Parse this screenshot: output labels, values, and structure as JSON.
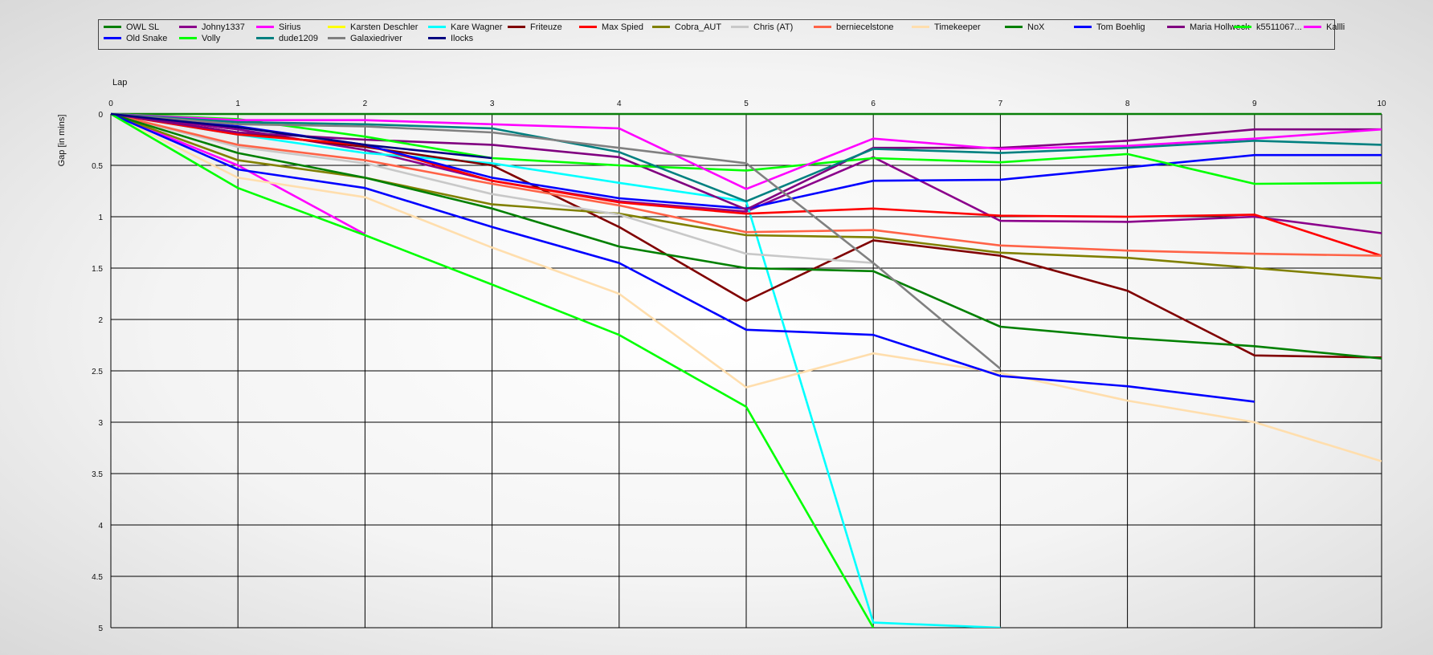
{
  "chart_data": {
    "type": "line",
    "xlabel": "Lap",
    "ylabel": "Gap [in mins]",
    "x_ticks": [
      "0",
      "1",
      "2",
      "3",
      "4",
      "5",
      "6",
      "7",
      "8",
      "9",
      "10"
    ],
    "y_ticks": [
      "0",
      "0.5",
      "1",
      "1.5",
      "2",
      "2.5",
      "3",
      "3.5",
      "4",
      "4.5",
      "5"
    ],
    "xlim": [
      0,
      10
    ],
    "ylim": [
      0,
      5
    ],
    "y_inverted": true,
    "grid": true,
    "legend_position": "top",
    "series": [
      {
        "name": "OWL SL",
        "color": "#087f08",
        "values": [
          0,
          0,
          0,
          0,
          0,
          0,
          0,
          0,
          0,
          0,
          0
        ]
      },
      {
        "name": "Johny1337",
        "color": "#8b008b",
        "values": [
          0,
          0.15,
          0.35,
          0.65,
          0.85,
          0.95,
          0.42,
          1.04,
          1.05,
          1.0,
          1.16
        ]
      },
      {
        "name": "Sirius",
        "color": "#ff00ff",
        "values": [
          0,
          0.5,
          1.17
        ]
      },
      {
        "name": "Karsten Deschler",
        "color": "#ffff00",
        "values": []
      },
      {
        "name": "Kare Wagner",
        "color": "#00ffff",
        "values": [
          0,
          0.2,
          0.38,
          0.48,
          0.67,
          0.85,
          4.95,
          5.0
        ]
      },
      {
        "name": "Friteuze",
        "color": "#800000",
        "values": [
          0,
          0.18,
          0.32,
          0.5,
          1.1,
          1.82,
          1.23,
          1.38,
          1.72,
          2.35,
          2.37
        ]
      },
      {
        "name": "Max Spied",
        "color": "#ff0000",
        "values": [
          0,
          0.2,
          0.3,
          0.65,
          0.86,
          0.97,
          0.92,
          0.99,
          1.0,
          0.98,
          1.38
        ]
      },
      {
        "name": "Cobra_AUT",
        "color": "#808000",
        "values": [
          0,
          0.45,
          0.62,
          0.88,
          0.97,
          1.18,
          1.2,
          1.35,
          1.4,
          1.5,
          1.6
        ]
      },
      {
        "name": "Chris (AT)",
        "color": "#c8c8c8",
        "values": [
          0,
          0.32,
          0.48,
          0.78,
          0.98,
          1.36,
          1.45
        ]
      },
      {
        "name": "berniecelstone",
        "color": "#ff6347",
        "values": [
          0,
          0.3,
          0.45,
          0.68,
          0.89,
          1.15,
          1.13,
          1.28,
          1.33,
          1.36,
          1.38
        ]
      },
      {
        "name": "Timekeeper",
        "color": "#ffdead",
        "values": [
          0,
          0.62,
          0.81,
          1.3,
          1.75,
          2.66,
          2.33,
          2.52,
          2.79,
          3.0,
          3.38
        ]
      },
      {
        "name": "NoX",
        "color": "#008000",
        "values": [
          0,
          0.38,
          0.62,
          0.92,
          1.29,
          1.5,
          1.53,
          2.07,
          2.18,
          2.26,
          2.38
        ]
      },
      {
        "name": "Tom Boehlig",
        "color": "#0000ff",
        "values": [
          0,
          0.12,
          0.3,
          0.62,
          0.82,
          0.92,
          0.65,
          0.64,
          0.52,
          0.4,
          0.4
        ]
      },
      {
        "name": "Maria Hollweck",
        "color": "#800080",
        "values": [
          0,
          0.18,
          0.25,
          0.3,
          0.42,
          0.93,
          0.33,
          0.33,
          0.26,
          0.15,
          0.15
        ]
      },
      {
        "name": "k5511067...",
        "color": "#00ff00",
        "values": [
          0,
          0.05,
          0.22,
          0.43,
          0.5,
          0.55,
          0.43,
          0.47,
          0.39,
          0.68,
          0.67
        ]
      },
      {
        "name": "Kallli",
        "color": "#ff00ff",
        "values": [
          0,
          0.06,
          0.06,
          0.1,
          0.14,
          0.73,
          0.24,
          0.34,
          0.31,
          0.24,
          0.15
        ]
      },
      {
        "name": "Old Snake",
        "color": "#0000ff",
        "values": [
          0,
          0.54,
          0.72,
          1.1,
          1.45,
          2.1,
          2.15,
          2.55,
          2.65,
          2.8
        ]
      },
      {
        "name": "Volly",
        "color": "#00ff00",
        "values": [
          0,
          0.72,
          1.18,
          1.66,
          2.15,
          2.85,
          5.0
        ]
      },
      {
        "name": "dude1209",
        "color": "#008080",
        "values": [
          0,
          0.08,
          0.1,
          0.14,
          0.37,
          0.85,
          0.34,
          0.38,
          0.33,
          0.26,
          0.3
        ]
      },
      {
        "name": "Galaxiedriver",
        "color": "#808080",
        "values": [
          0,
          0.1,
          0.12,
          0.18,
          0.33,
          0.48,
          1.45,
          2.48
        ]
      },
      {
        "name": "Ilocks",
        "color": "#000080",
        "values": [
          0,
          0.13,
          0.3,
          0.43
        ]
      }
    ]
  }
}
